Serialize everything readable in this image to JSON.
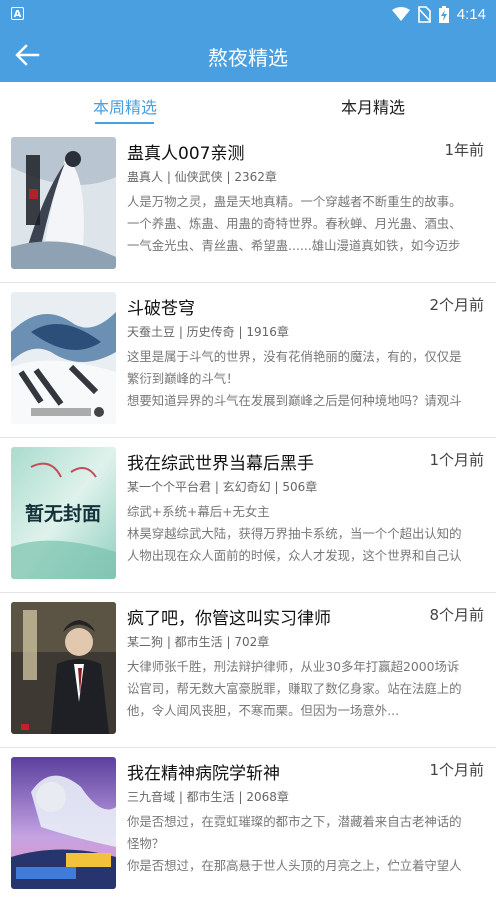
{
  "status_bar": {
    "time": "4:14"
  },
  "app_bar": {
    "title": "熬夜精选"
  },
  "tabs": [
    {
      "label": "本周精选"
    },
    {
      "label": "本月精选"
    }
  ],
  "books": [
    {
      "name": "蛊真人007亲测",
      "time": "1年前",
      "meta": "蛊真人 | 仙侠武侠 | 2362章",
      "desc": [
        "人是万物之灵，蛊是天地真精。一个穿越者不断重生的故事。",
        "一个养蛊、炼蛊、用蛊的奇特世界。春秋蝉、月光蛊、酒虫、",
        "一气金光虫、青丝蛊、希望蛊......雄山漫道真如铁，如今迈步"
      ]
    },
    {
      "name": "斗破苍穹",
      "time": "2个月前",
      "meta": "天蚕土豆 | 历史传奇 | 1916章",
      "desc": [
        "这里是属于斗气的世界，没有花俏艳丽的魔法，有的，仅仅是",
        "繁衍到巅峰的斗气！",
        "想要知道异界的斗气在发展到巅峰之后是何种境地吗？请观斗"
      ]
    },
    {
      "name": "我在综武世界当幕后黑手",
      "time": "1个月前",
      "meta": "某一个个平台君 | 玄幻奇幻 | 506章",
      "desc": [
        "综武+系统+幕后+无女主",
        "林昊穿越综武大陆，获得万界抽卡系统，当一个个超出认知的",
        "人物出现在众人面前的时候，众人才发现，这个世界和自己认"
      ],
      "cover_text": "暂无封面"
    },
    {
      "name": "疯了吧，你管这叫实习律师",
      "time": "8个月前",
      "meta": "某二狗 | 都市生活 | 702章",
      "desc": [
        "大律师张千胜，刑法辩护律师，从业30多年打赢超2000场诉",
        "讼官司，帮无数大富豪脱罪，赚取了数亿身家。站在法庭上的",
        "他，令人闻风丧胆，不寒而栗。但因为一场意外..."
      ]
    },
    {
      "name": "我在精神病院学斩神",
      "time": "1个月前",
      "meta": "三九音域 | 都市生活 | 2068章",
      "desc": [
        "你是否想过，在霓虹璀璨的都市之下，潜藏着来自古老神话的",
        "怪物？",
        "你是否想过，在那高悬于世人头顶的月亮之上，伫立着守望人"
      ]
    }
  ],
  "colors": {
    "accent": "#4a9fe0"
  }
}
